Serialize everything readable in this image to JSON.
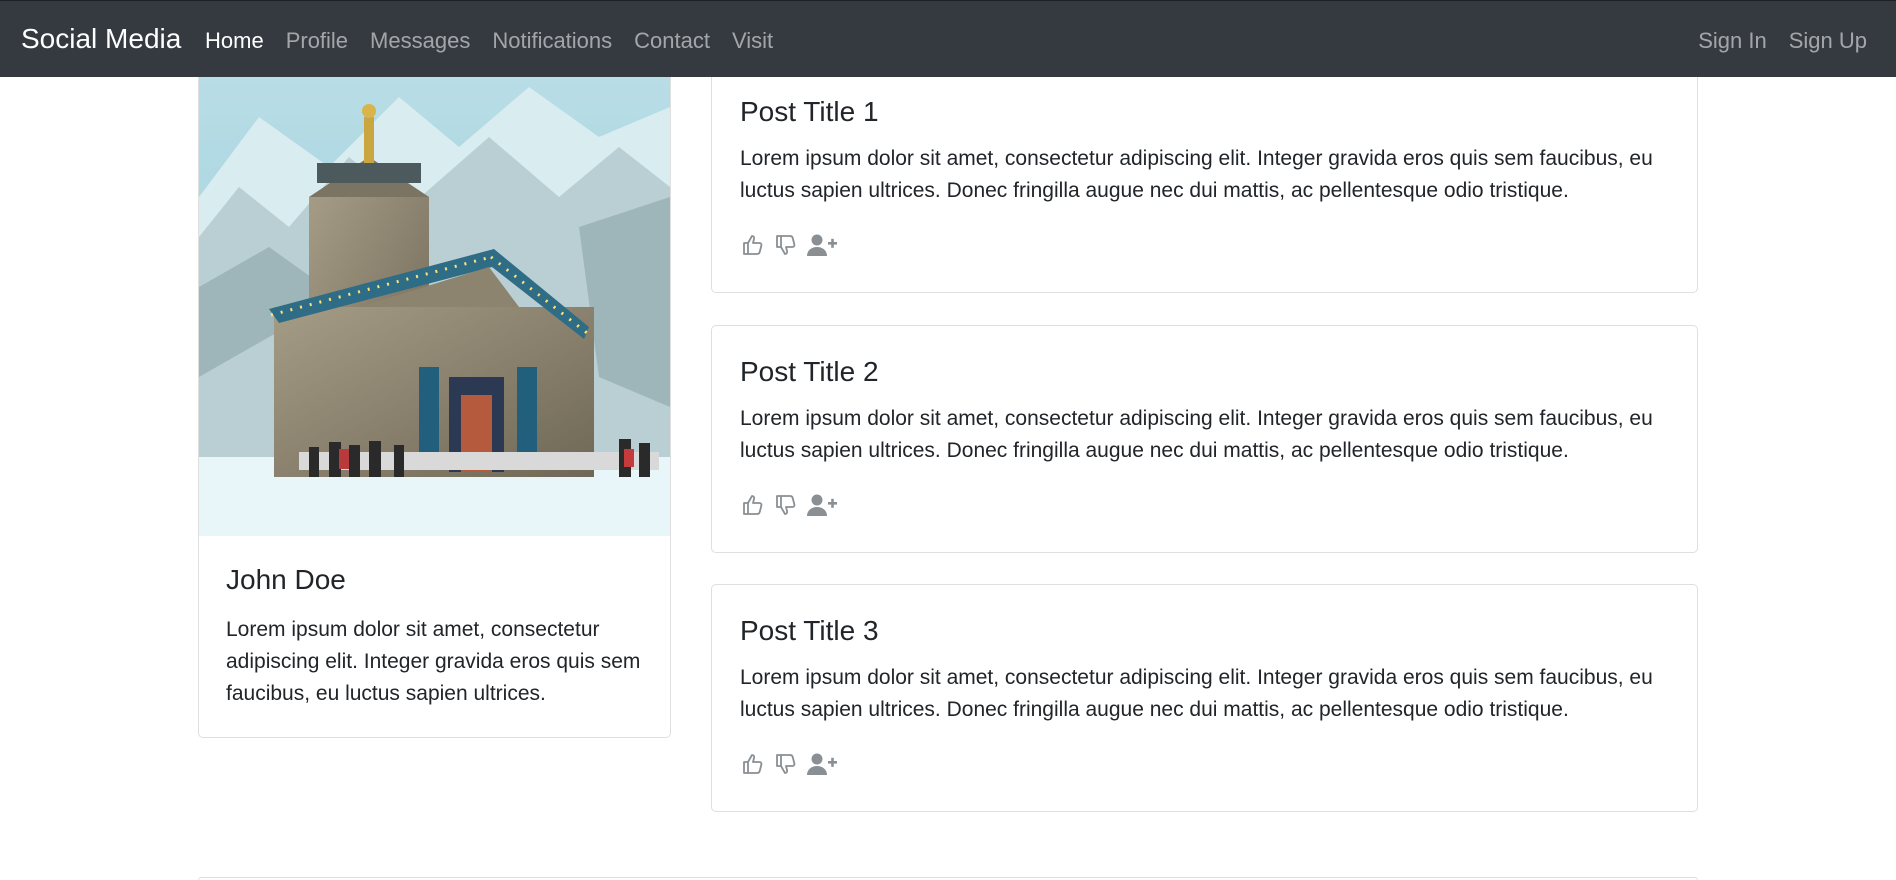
{
  "navbar": {
    "brand": "Social Media",
    "links": [
      {
        "label": "Home",
        "active": true
      },
      {
        "label": "Profile"
      },
      {
        "label": "Messages"
      },
      {
        "label": "Notifications"
      },
      {
        "label": "Contact"
      },
      {
        "label": "Visit"
      }
    ],
    "auth": [
      {
        "label": "Sign In"
      },
      {
        "label": "Sign Up"
      }
    ]
  },
  "profile": {
    "name": "John Doe",
    "bio": "Lorem ipsum dolor sit amet, consectetur adipiscing elit. Integer gravida eros quis sem faucibus, eu luctus sapien ultrices."
  },
  "posts": [
    {
      "title": "Post Title 1",
      "body": "Lorem ipsum dolor sit amet, consectetur adipiscing elit. Integer gravida eros quis sem faucibus, eu luctus sapien ultrices. Donec fringilla augue nec dui mattis, ac pellentesque odio tristique."
    },
    {
      "title": "Post Title 2",
      "body": "Lorem ipsum dolor sit amet, consectetur adipiscing elit. Integer gravida eros quis sem faucibus, eu luctus sapien ultrices. Donec fringilla augue nec dui mattis, ac pellentesque odio tristique."
    },
    {
      "title": "Post Title 3",
      "body": "Lorem ipsum dolor sit amet, consectetur adipiscing elit. Integer gravida eros quis sem faucibus, eu luctus sapien ultrices. Donec fringilla augue nec dui mattis, ac pellentesque odio tristique."
    }
  ],
  "icons": {
    "like": "thumbs-up-icon",
    "dislike": "thumbs-down-icon",
    "follow": "user-plus-icon"
  },
  "colors": {
    "navbar": "#343a40",
    "icon": "#8a8f94",
    "border": "#dfdfdf"
  }
}
